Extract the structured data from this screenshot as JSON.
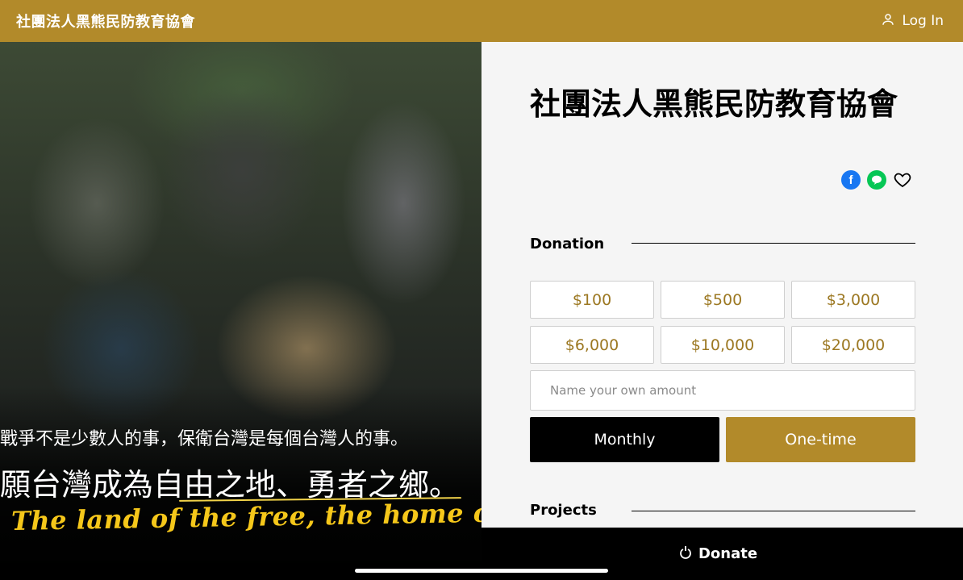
{
  "header": {
    "brand": "社團法人黑熊民防教育協會",
    "login_label": "Log In",
    "login_icon": "user-icon"
  },
  "hero": {
    "line1": "戰爭不是少數人的事，保衛台灣是每個台灣人的事。",
    "line2": "願台灣成為自由之地、勇者之鄉。",
    "script": "The land of the free, the home of the brave.",
    "script_color": "#f5c71a"
  },
  "panel": {
    "title": "社團法人黑熊民防教育協會",
    "social_icons": [
      "facebook-icon",
      "line-icon",
      "heart-icon"
    ],
    "donation_heading": "Donation",
    "amounts": [
      "$100",
      "$500",
      "$3,000",
      "$6,000",
      "$10,000",
      "$20,000"
    ],
    "custom_placeholder": "Name your own amount",
    "monthly_label": "Monthly",
    "onetime_label": "One-time",
    "projects_heading": "Projects"
  },
  "footer": {
    "donate_label": "Donate",
    "donate_icon": "donate-hand-icon"
  },
  "colors": {
    "brand_gold": "#b28a2a",
    "amount_text": "#9c7822",
    "panel_bg": "#f5f5f5"
  }
}
